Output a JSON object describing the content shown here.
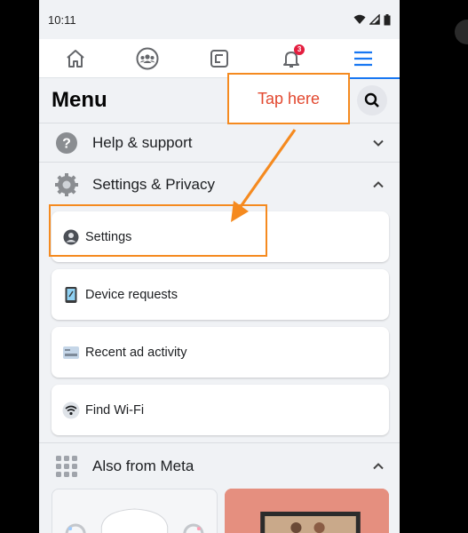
{
  "status": {
    "time": "10:11"
  },
  "nav": {
    "tabs": [
      {
        "name": "home",
        "icon": "home-icon"
      },
      {
        "name": "groups",
        "icon": "groups-icon"
      },
      {
        "name": "gaming",
        "icon": "gaming-icon"
      },
      {
        "name": "notifications",
        "icon": "bell-icon",
        "badge": "3"
      },
      {
        "name": "menu",
        "icon": "hamburger-icon",
        "active": true
      }
    ]
  },
  "menu": {
    "title": "Menu"
  },
  "sections": {
    "help": "Help & support",
    "settings_privacy": "Settings & Privacy",
    "also_meta": "Also from Meta"
  },
  "cards": [
    {
      "label": "Settings",
      "icon": "account-icon"
    },
    {
      "label": "Device requests",
      "icon": "device-icon"
    },
    {
      "label": "Recent ad activity",
      "icon": "ad-activity-icon"
    },
    {
      "label": "Find Wi-Fi",
      "icon": "wifi-icon"
    }
  ],
  "annotation": {
    "callout_text": "Tap here"
  },
  "colors": {
    "accent": "#1877f2",
    "annotation": "#f58a1f",
    "callout_text": "#e2482f",
    "badge": "#e41e3f"
  }
}
